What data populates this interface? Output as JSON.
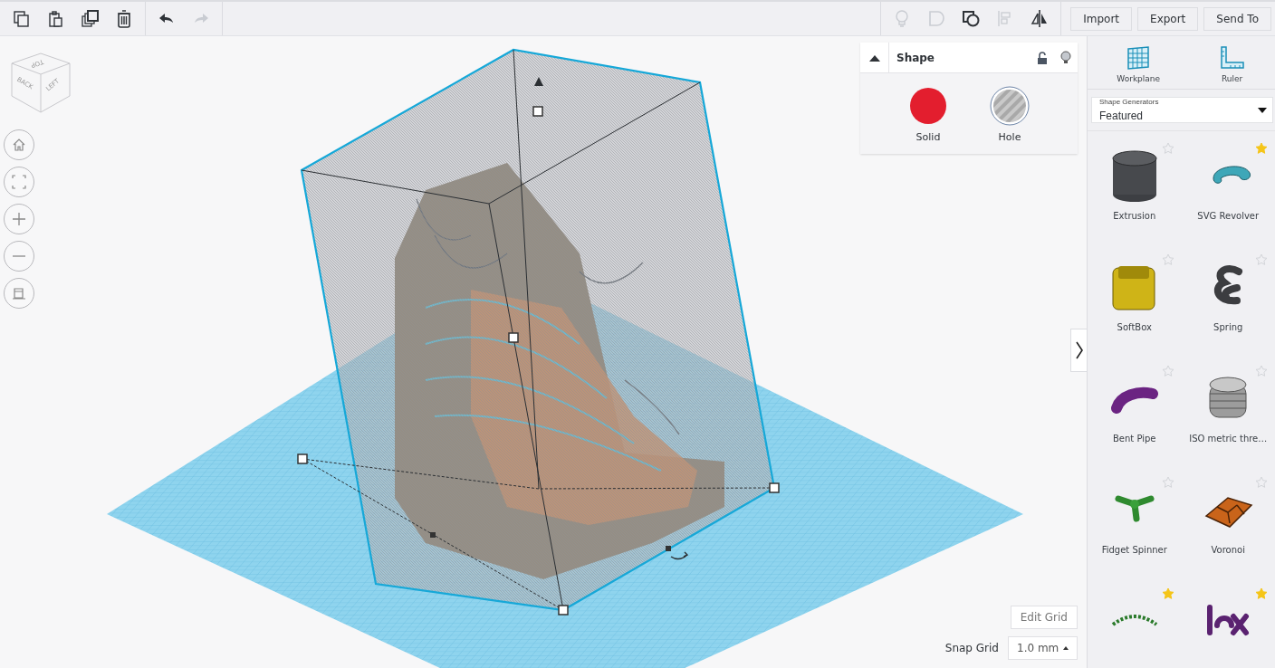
{
  "toolbar": {
    "edit_tools": [
      {
        "kind": "copy",
        "disabled": false
      },
      {
        "kind": "paste",
        "disabled": false
      },
      {
        "kind": "duplicate",
        "disabled": false
      },
      {
        "kind": "delete",
        "disabled": false
      }
    ],
    "history_tools": [
      {
        "kind": "undo",
        "disabled": false
      },
      {
        "kind": "redo",
        "disabled": true
      }
    ],
    "shape_tools": [
      {
        "kind": "bulb",
        "disabled": true
      },
      {
        "kind": "group",
        "disabled": true
      },
      {
        "kind": "ungroup",
        "disabled": false
      },
      {
        "kind": "align",
        "disabled": true
      },
      {
        "kind": "mirror",
        "disabled": false
      }
    ],
    "buttons": [
      "Import",
      "Export",
      "Send To"
    ]
  },
  "view_cube": {
    "faces": [
      "TOP",
      "BACK",
      "LEFT"
    ]
  },
  "nav_controls": [
    {
      "kind": "home"
    },
    {
      "kind": "fit"
    },
    {
      "kind": "zoom-in"
    },
    {
      "kind": "zoom-out"
    },
    {
      "kind": "perspective"
    }
  ],
  "shape_inspector": {
    "title": "Shape",
    "locked": false,
    "options": [
      {
        "label": "Solid",
        "kind": "solid"
      },
      {
        "label": "Hole",
        "kind": "hole"
      }
    ]
  },
  "panel": {
    "tools": [
      {
        "label": "Workplane",
        "kind": "workplane"
      },
      {
        "label": "Ruler",
        "kind": "ruler"
      }
    ],
    "library": {
      "label": "Shape Generators",
      "value": "Featured"
    },
    "shapes": [
      {
        "label": "Extrusion",
        "kind": "cylinder",
        "favorite": false
      },
      {
        "label": "SVG Revolver",
        "kind": "torus",
        "favorite": true
      },
      {
        "label": "SoftBox",
        "kind": "box",
        "favorite": false
      },
      {
        "label": "Spring",
        "kind": "spring",
        "favorite": false
      },
      {
        "label": "Bent Pipe",
        "kind": "pipe",
        "favorite": false
      },
      {
        "label": "ISO metric thre…",
        "kind": "thread",
        "favorite": false
      },
      {
        "label": "Fidget Spinner",
        "kind": "spinner",
        "favorite": false
      },
      {
        "label": "Voronoi",
        "kind": "voronoi",
        "favorite": false
      },
      {
        "kind": "arc",
        "favorite": true
      },
      {
        "kind": "letters",
        "favorite": true
      }
    ]
  },
  "grid": {
    "edit_button": "Edit Grid",
    "snap_label": "Snap Grid",
    "snap_value": "1.0 mm"
  }
}
